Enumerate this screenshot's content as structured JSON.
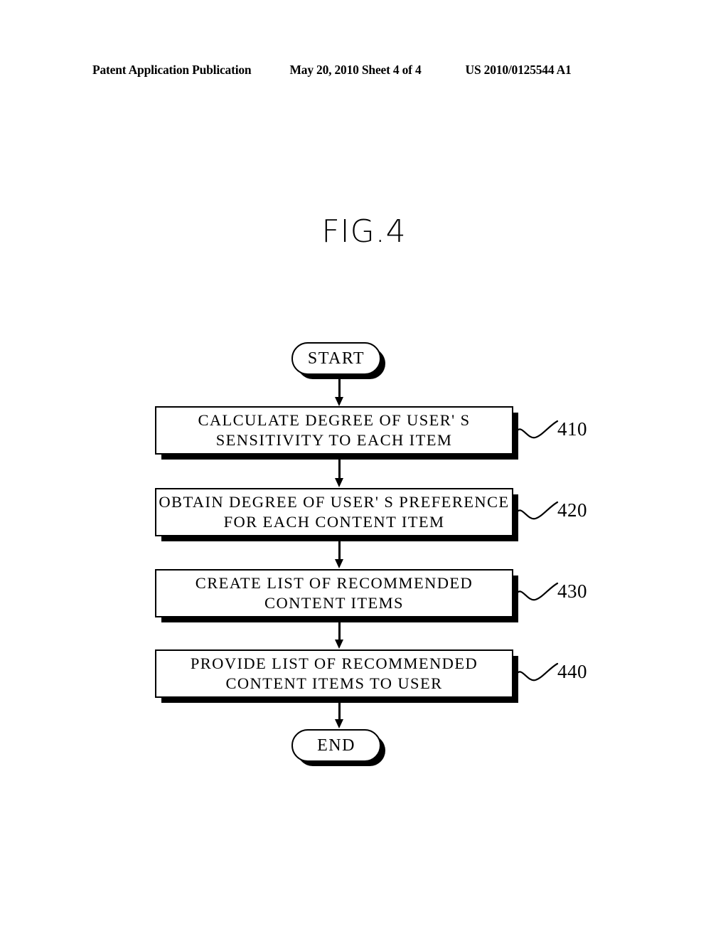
{
  "header": {
    "left": "Patent Application Publication",
    "middle": "May 20, 2010  Sheet 4 of 4",
    "right": "US 2010/0125544 A1"
  },
  "figure": {
    "title": "FIG.4",
    "start_label": "START",
    "end_label": "END",
    "steps": [
      {
        "ref": "410",
        "line1": "CALCULATE DEGREE OF USER' S",
        "line2": "SENSITIVITY TO EACH ITEM"
      },
      {
        "ref": "420",
        "line1": "OBTAIN DEGREE OF USER' S PREFERENCE",
        "line2": "FOR EACH CONTENT ITEM"
      },
      {
        "ref": "430",
        "line1": "CREATE LIST OF RECOMMENDED",
        "line2": "CONTENT ITEMS"
      },
      {
        "ref": "440",
        "line1": "PROVIDE LIST OF RECOMMENDED",
        "line2": "CONTENT ITEMS TO USER"
      }
    ]
  },
  "colors": {
    "ink": "#000000",
    "paper": "#ffffff"
  }
}
